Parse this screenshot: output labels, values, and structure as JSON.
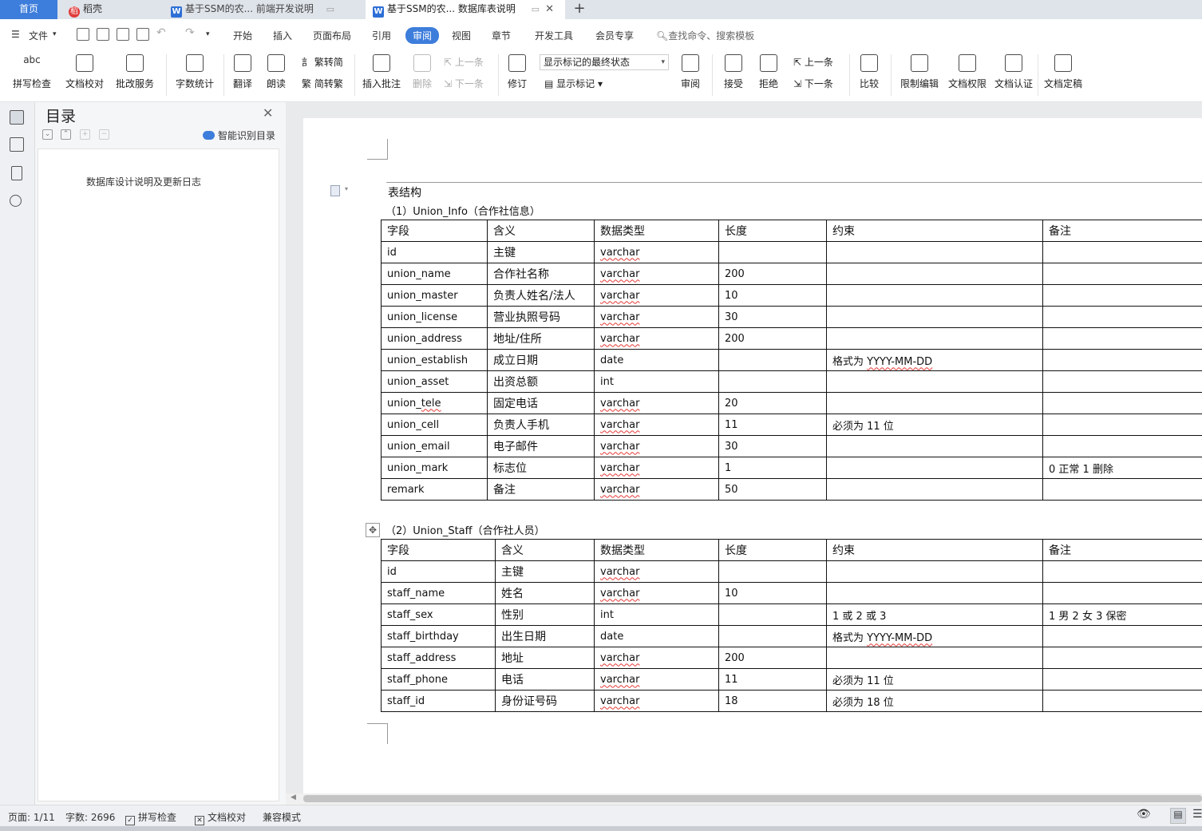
{
  "tabs": {
    "home": "首页",
    "daoke": "稻壳",
    "doc1": "基于SSM的农... 前端开发说明",
    "doc2": "基于SSM的农... 数据库表说明",
    "doc_icon_letter": "W",
    "close": "✕",
    "add": "+"
  },
  "menu": {
    "file": "文件",
    "items": [
      "开始",
      "插入",
      "页面布局",
      "引用",
      "审阅",
      "视图",
      "章节",
      "开发工具",
      "会员专享"
    ],
    "active": "审阅",
    "search_placeholder": "查找命令、搜索模板"
  },
  "ribbon": {
    "spell_check": "拼写检查",
    "doc_proofread": "文档校对",
    "batch_service": "批改服务",
    "word_count": "字数统计",
    "translate": "翻译",
    "read_aloud": "朗读",
    "trad_to_simp": "繁转简",
    "simp_to_trad": "简转繁",
    "insert_comment": "插入批注",
    "delete": "删除",
    "prev": "上一条",
    "next": "下一条",
    "revise": "修订",
    "show_mode": "显示标记的最终状态",
    "show_markup": "显示标记",
    "review": "审阅",
    "accept": "接受",
    "reject": "拒绝",
    "prev2": "上一条",
    "next2": "下一条",
    "compare": "比较",
    "restrict_edit": "限制编辑",
    "doc_permission": "文档权限",
    "doc_cert": "文档认证",
    "doc_finalize": "文档定稿",
    "spell_icon_text": "abc"
  },
  "toc": {
    "title": "目录",
    "smart": "智能识别目录",
    "entry": "数据库设计说明及更新日志"
  },
  "document": {
    "section_title": "表结构",
    "table1_caption": "（1）Union_Info（合作社信息）",
    "table2_caption": "（2）Union_Staff（合作社人员）",
    "headers": [
      "字段",
      "含义",
      "数据类型",
      "长度",
      "约束",
      "备注"
    ],
    "table1_rows": [
      [
        "id",
        "主键",
        "varchar",
        "",
        "",
        ""
      ],
      [
        "union_name",
        "合作社名称",
        "varchar",
        "200",
        "",
        ""
      ],
      [
        "union_master",
        "负责人姓名/法人",
        "varchar",
        "10",
        "",
        ""
      ],
      [
        "union_license",
        "营业执照号码",
        "varchar",
        "30",
        "",
        ""
      ],
      [
        "union_address",
        "地址/住所",
        "varchar",
        "200",
        "",
        ""
      ],
      [
        "union_establish",
        "成立日期",
        "date",
        "",
        "格式为 YYYY-MM-DD",
        ""
      ],
      [
        "union_asset",
        "出资总额",
        "int",
        "",
        "",
        ""
      ],
      [
        "union_tele",
        "固定电话",
        "varchar",
        "20",
        "",
        ""
      ],
      [
        "union_cell",
        "负责人手机",
        "varchar",
        "11",
        "必须为 11 位",
        ""
      ],
      [
        "union_email",
        "电子邮件",
        "varchar",
        "30",
        "",
        ""
      ],
      [
        "union_mark",
        "标志位",
        "varchar",
        "1",
        "",
        "0 正常 1 删除"
      ],
      [
        "remark",
        "备注",
        "varchar",
        "50",
        "",
        ""
      ]
    ],
    "table2_rows": [
      [
        "id",
        "主键",
        "varchar",
        "",
        "",
        ""
      ],
      [
        "staff_name",
        "姓名",
        "varchar",
        "10",
        "",
        ""
      ],
      [
        "staff_sex",
        "性别",
        "int",
        "",
        "1 或 2 或 3",
        "1 男  2 女  3 保密"
      ],
      [
        "staff_birthday",
        "出生日期",
        "date",
        "",
        "格式为 YYYY-MM-DD",
        ""
      ],
      [
        "staff_address",
        "地址",
        "varchar",
        "200",
        "",
        ""
      ],
      [
        "staff_phone",
        "电话",
        "varchar",
        "11",
        "必须为 11 位",
        ""
      ],
      [
        "staff_id",
        "身份证号码",
        "varchar",
        "18",
        "必须为 18 位",
        ""
      ]
    ]
  },
  "status": {
    "page": "页面: 1/11",
    "word_count": "字数: 2696",
    "spell_check": "拼写检查",
    "doc_proofread": "文档校对",
    "compat_mode": "兼容模式"
  },
  "colors": {
    "accent": "#3d7ddb",
    "squiggle": "#e53935"
  }
}
